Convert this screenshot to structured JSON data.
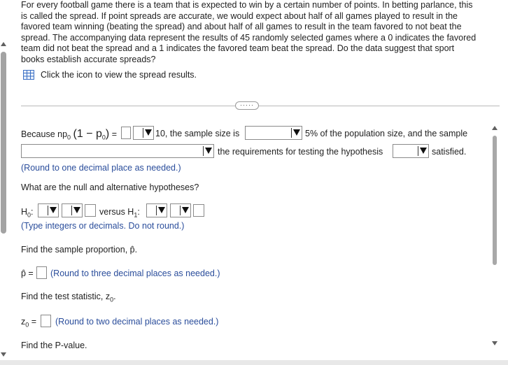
{
  "question": {
    "lines": [
      "For every football game there is a team that is expected to win by a certain number of points. In betting parlance, this",
      "is called the spread. If point spreads are accurate, we would expect about half of all games played to result in the",
      "favored team winning (beating the spread) and about half of all games to result in the team favored to not beat the",
      "spread. The accompanying data represent the results of 45 randomly selected games where a 0 indicates the favored",
      "team did not beat the spread and a 1 indicates the favored team beat the spread. Do the data suggest that sport",
      "books establish accurate spreads?"
    ],
    "data_link": "Click the icon to view the spread results."
  },
  "condition": {
    "prefix": "Because np",
    "sub0": "0",
    "paren_open": "(1 − p",
    "sub1": "0",
    "paren_close": ")",
    "equals": "=",
    "ten_text": "10, the sample size is",
    "pct_text": "5% of the population size, and the sample",
    "req_text": "the requirements for testing the hypothesis",
    "satisfied_text": "satisfied.",
    "round_hint": "(Round to one decimal place as needed.)"
  },
  "hypotheses": {
    "question": "What are the null and alternative hypotheses?",
    "h0": "H",
    "h0_sub": "0",
    "colon": ":",
    "versus": "versus H",
    "h1_sub": "1",
    "hint": "(Type integers or decimals. Do not round.)"
  },
  "proportion": {
    "question": "Find the sample proportion, p̂.",
    "label": "p̂ =",
    "hint": "(Round to three decimal places as needed.)"
  },
  "statistic": {
    "question": "Find the test statistic, z",
    "question_sub": "0",
    "question_end": ".",
    "label": "z",
    "label_sub": "0",
    "eq": " =",
    "hint": "(Round to two decimal places as needed.)"
  },
  "pvalue": {
    "question": "Find the P-value."
  },
  "ellipsis": "·····"
}
